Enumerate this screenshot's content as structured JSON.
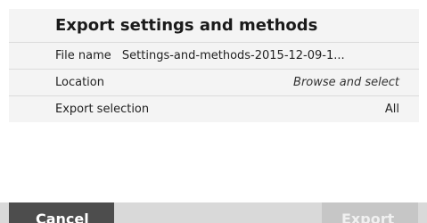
{
  "panel": {
    "title": "Export settings and methods",
    "rows": [
      {
        "label": "File name",
        "value": "Settings-and-methods-2015-12-09-1..."
      },
      {
        "label": "Location",
        "value": "Browse and select"
      },
      {
        "label": "Export selection",
        "value": "All"
      }
    ]
  },
  "footer": {
    "left_button_label": "Cancel",
    "right_button_label": "Export"
  }
}
